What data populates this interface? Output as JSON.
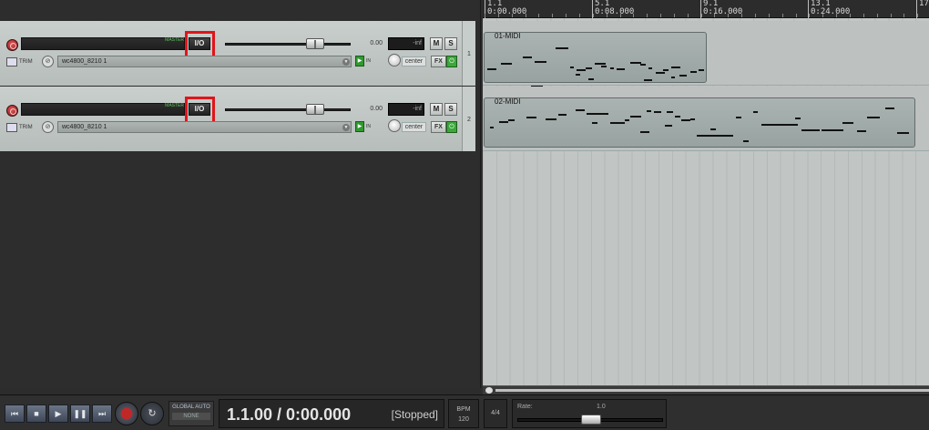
{
  "tracks": [
    {
      "number": "1",
      "io_label": "I/O",
      "volume": "0.00",
      "peak": "-inf",
      "mute": "M",
      "solo": "S",
      "trim": "TRIM",
      "input": "wc4800_8210 1",
      "in_label": "IN",
      "pan": "center",
      "fx": "FX",
      "meter_text": "MASTER"
    },
    {
      "number": "2",
      "io_label": "I/O",
      "volume": "0.00",
      "peak": "-inf",
      "mute": "M",
      "solo": "S",
      "trim": "TRIM",
      "input": "wc4800_8210 1",
      "in_label": "IN",
      "pan": "center",
      "fx": "FX",
      "meter_text": "MASTER"
    }
  ],
  "ruler": {
    "marks": [
      {
        "bar": "1.1",
        "time": "0:00.000"
      },
      {
        "bar": "5.1",
        "time": "0:08.000"
      },
      {
        "bar": "9.1",
        "time": "0:16.000"
      },
      {
        "bar": "13.1",
        "time": "0:24.000"
      },
      {
        "bar": "17",
        "time": ""
      }
    ]
  },
  "items": [
    {
      "name": "01-MIDI",
      "notes": [
        [
          3,
          39,
          10
        ],
        [
          18,
          33,
          12
        ],
        [
          42,
          26,
          10
        ],
        [
          55,
          31,
          13
        ],
        [
          78,
          16,
          14
        ],
        [
          94,
          37,
          4
        ],
        [
          101,
          40,
          10
        ],
        [
          111,
          38,
          7
        ],
        [
          121,
          33,
          12
        ],
        [
          128,
          36,
          6
        ],
        [
          138,
          38,
          4
        ],
        [
          145,
          39,
          9
        ],
        [
          160,
          32,
          12
        ],
        [
          171,
          34,
          6
        ],
        [
          180,
          38,
          4
        ],
        [
          188,
          43,
          10
        ],
        [
          196,
          40,
          6
        ],
        [
          205,
          37,
          10
        ],
        [
          214,
          46,
          8
        ],
        [
          226,
          42,
          7
        ],
        [
          235,
          40,
          6
        ],
        [
          51,
          58,
          13
        ],
        [
          87,
          61,
          8
        ],
        [
          100,
          45,
          5
        ],
        [
          114,
          50,
          6
        ],
        [
          175,
          51,
          9
        ],
        [
          205,
          48,
          4
        ]
      ]
    },
    {
      "name": "02-MIDI",
      "notes": [
        [
          6,
          31,
          4
        ],
        [
          16,
          25,
          10
        ],
        [
          26,
          23,
          7
        ],
        [
          46,
          20,
          11
        ],
        [
          67,
          22,
          12
        ],
        [
          81,
          17,
          9
        ],
        [
          100,
          12,
          10
        ],
        [
          112,
          16,
          24
        ],
        [
          138,
          26,
          16
        ],
        [
          154,
          23,
          5
        ],
        [
          160,
          19,
          12
        ],
        [
          178,
          13,
          5
        ],
        [
          186,
          14,
          8
        ],
        [
          200,
          14,
          7
        ],
        [
          209,
          19,
          6
        ],
        [
          216,
          23,
          10
        ],
        [
          233,
          40,
          40
        ],
        [
          276,
          20,
          6
        ],
        [
          284,
          46,
          6
        ],
        [
          295,
          14,
          5
        ],
        [
          304,
          28,
          40
        ],
        [
          341,
          21,
          6
        ],
        [
          348,
          34,
          20
        ],
        [
          370,
          34,
          24
        ],
        [
          393,
          26,
          12
        ],
        [
          409,
          35,
          10
        ],
        [
          420,
          20,
          14
        ],
        [
          440,
          10,
          10
        ],
        [
          453,
          37,
          13
        ],
        [
          118,
          26,
          6
        ],
        [
          171,
          36,
          10
        ],
        [
          198,
          29,
          8
        ],
        [
          226,
          22,
          5
        ],
        [
          248,
          33,
          6
        ]
      ]
    }
  ],
  "transport": {
    "global_auto": "GLOBAL AUTO",
    "global_auto_mode": "NONE",
    "position": "1.1.00 / 0:00.000",
    "state": "[Stopped]",
    "bpm_label": "BPM",
    "bpm_value": "120",
    "time_sig": "4/4",
    "rate_label": "Rate:",
    "rate_value": "1.0"
  },
  "colors": {
    "record_red": "#c02828",
    "highlight": "#e0151a",
    "monitor_green": "#2f9a2f"
  }
}
